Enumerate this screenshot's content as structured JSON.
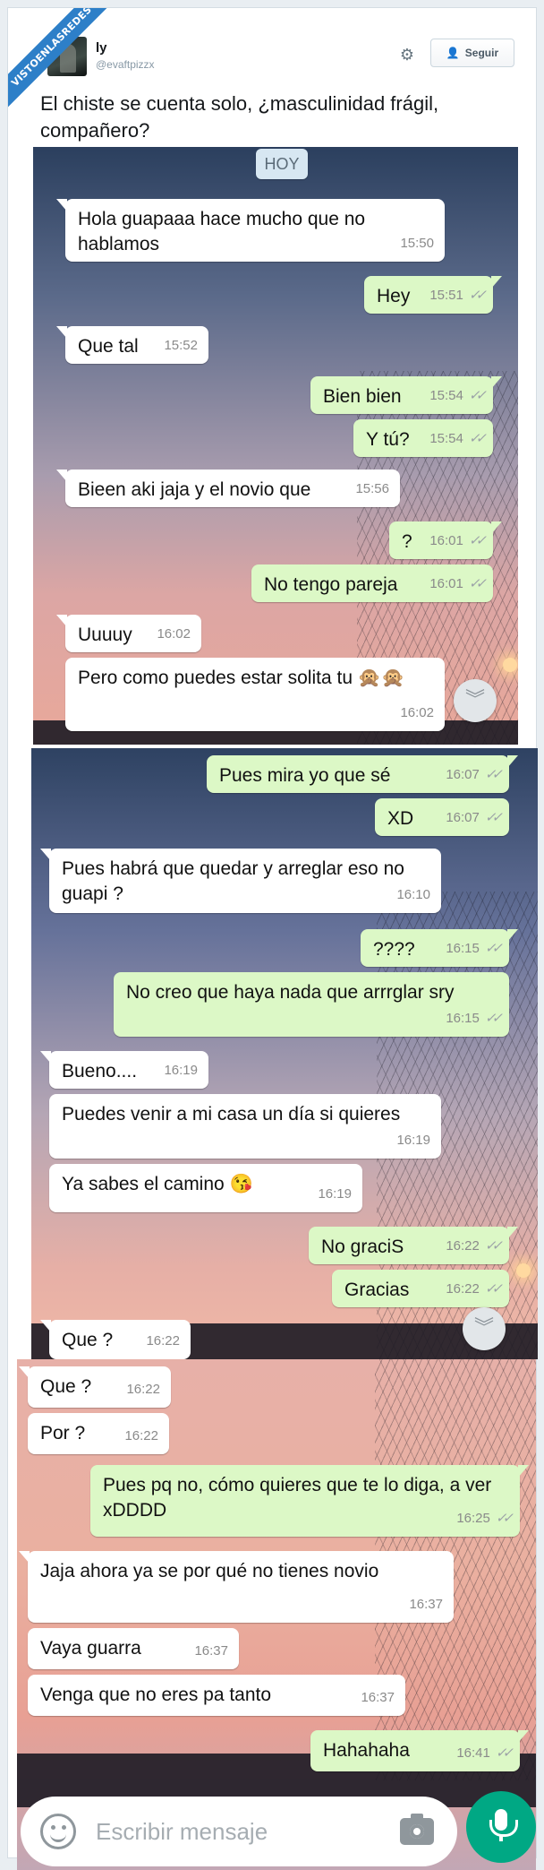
{
  "watermark": "VISTOENLASREDES",
  "tweet": {
    "name": "ly",
    "handle": "@evaftpizzx",
    "follow_label": "Seguir",
    "text": "El chiste se cuenta solo, ¿masculinidad frágil, compañero?"
  },
  "chat": {
    "date_label": "HOY",
    "screen1": [
      {
        "dir": "in",
        "text": "Hola guapaaa hace mucho que no hablamos",
        "time": "15:50"
      },
      {
        "dir": "out",
        "text": "Hey",
        "time": "15:51"
      },
      {
        "dir": "in",
        "text": "Que tal",
        "time": "15:52"
      },
      {
        "dir": "out",
        "text": "Bien bien",
        "time": "15:54"
      },
      {
        "dir": "out",
        "text": "Y tú?",
        "time": "15:54"
      },
      {
        "dir": "in",
        "text": "Bieen aki jaja y el novio que",
        "time": "15:56"
      },
      {
        "dir": "out",
        "text": "?",
        "time": "16:01"
      },
      {
        "dir": "out",
        "text": "No tengo pareja",
        "time": "16:01"
      },
      {
        "dir": "in",
        "text": "Uuuuy",
        "time": "16:02"
      },
      {
        "dir": "in",
        "text": "Pero como puedes estar solita tu 🙊🙊",
        "time": "16:02"
      }
    ],
    "screen2": [
      {
        "dir": "out",
        "text": "Pues mira yo que sé",
        "time": "16:07"
      },
      {
        "dir": "out",
        "text": "XD",
        "time": "16:07"
      },
      {
        "dir": "in",
        "text": "Pues habrá que quedar y arreglar eso no guapi ?",
        "time": "16:10"
      },
      {
        "dir": "out",
        "text": "????",
        "time": "16:15"
      },
      {
        "dir": "out",
        "text": "No creo que haya nada que arrrglar sry",
        "time": "16:15"
      },
      {
        "dir": "in",
        "text": "Bueno....",
        "time": "16:19"
      },
      {
        "dir": "in",
        "text": "Puedes venir a mi casa un día si quieres",
        "time": "16:19"
      },
      {
        "dir": "in",
        "text": "Ya sabes el camino 😘",
        "time": "16:19"
      },
      {
        "dir": "out",
        "text": "No graciS",
        "time": "16:22"
      },
      {
        "dir": "out",
        "text": "Gracias",
        "time": "16:22"
      },
      {
        "dir": "in",
        "text": "Que ?",
        "time": "16:22"
      }
    ],
    "screen3": [
      {
        "dir": "in",
        "text": "Que ?",
        "time": "16:22"
      },
      {
        "dir": "in",
        "text": "Por ?",
        "time": "16:22"
      },
      {
        "dir": "out",
        "text": "Pues pq no, cómo quieres que te lo diga, a ver xDDDD",
        "time": "16:25"
      },
      {
        "dir": "in",
        "text": "Jaja ahora ya se por qué no tienes novio",
        "time": "16:37"
      },
      {
        "dir": "in",
        "text": "Vaya guarra",
        "time": "16:37"
      },
      {
        "dir": "in",
        "text": "Venga que no eres pa tanto",
        "time": "16:37"
      },
      {
        "dir": "out",
        "text": "Hahahaha",
        "time": "16:41"
      }
    ],
    "composer_placeholder": "Escribir mensaje"
  },
  "icons": [
    "gear-icon",
    "add-user-icon",
    "chevron-double-down-icon",
    "emoji-icon",
    "camera-icon",
    "mic-icon"
  ],
  "colors": {
    "incoming": "#ffffff",
    "outgoing": "#dcf8c6",
    "mic": "#00a884",
    "watermark": "#2d7fc8"
  }
}
